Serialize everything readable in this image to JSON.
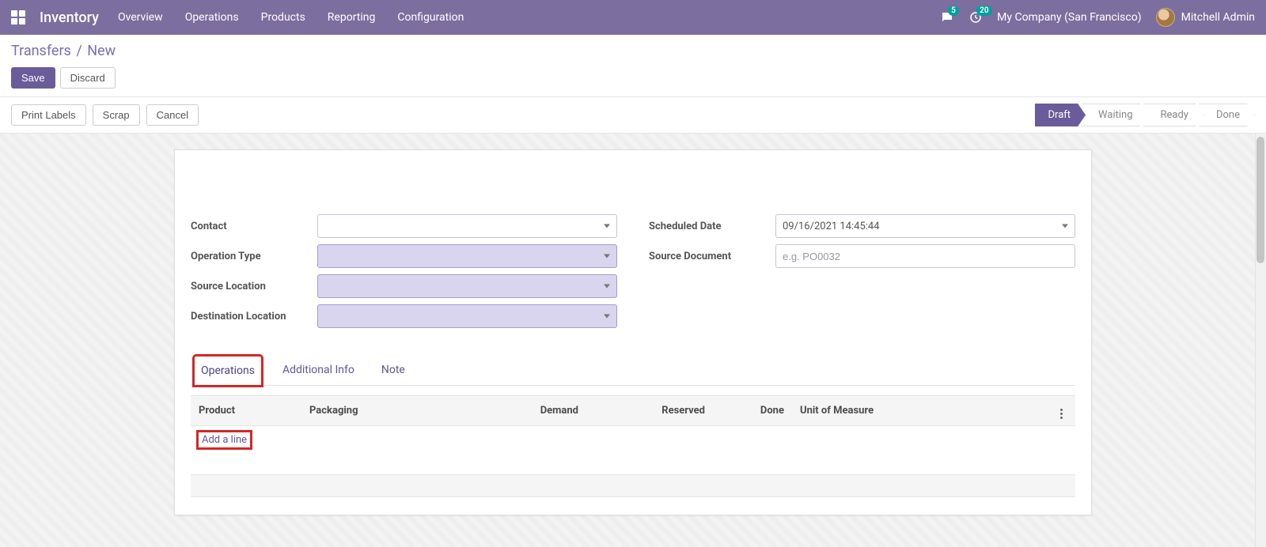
{
  "topnav": {
    "brand": "Inventory",
    "menu": [
      "Overview",
      "Operations",
      "Products",
      "Reporting",
      "Configuration"
    ],
    "messages_badge": "5",
    "activities_badge": "20",
    "company": "My Company (San Francisco)",
    "user": "Mitchell Admin"
  },
  "breadcrumb": {
    "parent": "Transfers",
    "sep": "/",
    "current": "New"
  },
  "cp_buttons": {
    "save": "Save",
    "discard": "Discard"
  },
  "toolbar": {
    "print_labels": "Print Labels",
    "scrap": "Scrap",
    "cancel": "Cancel"
  },
  "status": [
    "Draft",
    "Waiting",
    "Ready",
    "Done"
  ],
  "form": {
    "left": {
      "contact": "Contact",
      "operation_type": "Operation Type",
      "source_location": "Source Location",
      "destination_location": "Destination Location"
    },
    "right": {
      "scheduled_date": "Scheduled Date",
      "scheduled_date_value": "09/16/2021 14:45:44",
      "source_document": "Source Document",
      "source_document_placeholder": "e.g. PO0032"
    }
  },
  "tabs": [
    "Operations",
    "Additional Info",
    "Note"
  ],
  "table": {
    "headers": {
      "product": "Product",
      "packaging": "Packaging",
      "demand": "Demand",
      "reserved": "Reserved",
      "done": "Done",
      "uom": "Unit of Measure"
    },
    "add_line": "Add a line"
  }
}
